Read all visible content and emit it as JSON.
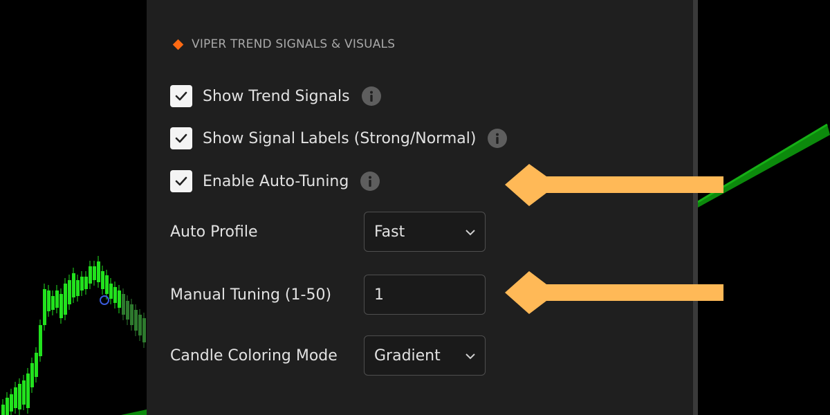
{
  "section": {
    "title": "VIPER TREND SIGNALS & VISUALS",
    "icon": "diamond-icon",
    "accent_color": "#ff6a13"
  },
  "checkboxes": [
    {
      "label": "Show Trend Signals",
      "checked": true
    },
    {
      "label": "Show Signal Labels (Strong/Normal)",
      "checked": true
    },
    {
      "label": "Enable Auto-Tuning",
      "checked": true
    }
  ],
  "fields": {
    "auto_profile": {
      "label": "Auto Profile",
      "value": "Fast"
    },
    "manual_tuning": {
      "label": "Manual Tuning (1-50)",
      "value": "1"
    },
    "candle_coloring": {
      "label": "Candle Coloring Mode",
      "value": "Gradient"
    }
  },
  "annotations": {
    "arrow_color": "#ffb957",
    "count": 2
  },
  "chart_colors": {
    "bull_candle": "#22e21e",
    "trend_line": "#0c8a0c"
  }
}
